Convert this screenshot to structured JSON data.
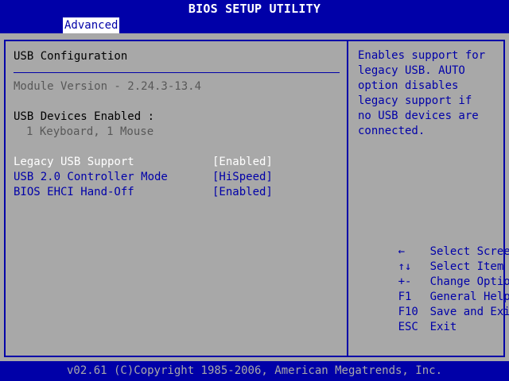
{
  "title": "BIOS SETUP UTILITY",
  "menu": {
    "active_tab": "Advanced"
  },
  "section_title": "USB Configuration",
  "module_version": "Module Version - 2.24.3-13.4",
  "devices_label": "USB Devices Enabled :",
  "devices_value": "1 Keyboard, 1 Mouse",
  "settings": [
    {
      "label": "Legacy USB Support",
      "value": "[Enabled]",
      "selected": true
    },
    {
      "label": "USB 2.0 Controller Mode",
      "value": "[HiSpeed]",
      "selected": false
    },
    {
      "label": "BIOS EHCI Hand-Off",
      "value": "[Enabled]",
      "selected": false
    }
  ],
  "help_text": [
    "Enables support for",
    "legacy USB. AUTO",
    "option disables",
    "legacy support if",
    "no USB devices are",
    "connected."
  ],
  "keys": [
    {
      "key": "←",
      "desc": "Select Screen"
    },
    {
      "key": "↑↓",
      "desc": "Select Item"
    },
    {
      "key": "+-",
      "desc": "Change Option"
    },
    {
      "key": "F1",
      "desc": "General Help"
    },
    {
      "key": "F10",
      "desc": "Save and Exit"
    },
    {
      "key": "ESC",
      "desc": "Exit"
    }
  ],
  "footer": "v02.61 (C)Copyright 1985-2006, American Megatrends, Inc.",
  "colors": {
    "background_blue": "#0000a8",
    "panel_gray": "#a8a8a8",
    "highlight_white": "#ffffff"
  }
}
